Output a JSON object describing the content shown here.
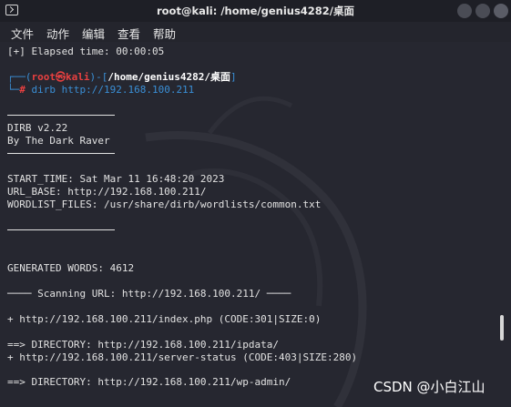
{
  "window": {
    "title": "root@kali: /home/genius4282/桌面"
  },
  "menu": [
    "文件",
    "动作",
    "编辑",
    "查看",
    "帮助"
  ],
  "terminal": {
    "elapsed": "[+] Elapsed time: 00:00:05",
    "prompt": {
      "open": "┌──(",
      "user": "root㉿kali",
      "mid": ")-[",
      "path": "/home/genius4282/桌面",
      "close": "]",
      "hash_prefix": "└─",
      "hash": "#",
      "command": " dirb http://192.168.100.211"
    },
    "dirb_version": "DIRB v2.22",
    "dirb_author": "By The Dark Raver",
    "start_time": "START_TIME: Sat Mar 11 16:48:20 2023",
    "url_base": "URL_BASE: http://192.168.100.211/",
    "wordlist": "WORDLIST_FILES: /usr/share/dirb/wordlists/common.txt",
    "generated_words": "GENERATED WORDS: 4612",
    "scanning": "──── Scanning URL: http://192.168.100.211/ ────",
    "result1": "+ http://192.168.100.211/index.php (CODE:301|SIZE:0)",
    "dir1": "==> DIRECTORY: http://192.168.100.211/ipdata/",
    "result2": "+ http://192.168.100.211/server-status (CODE:403|SIZE:280)",
    "dir2": "==> DIRECTORY: http://192.168.100.211/wp-admin/"
  },
  "watermark": "CSDN @小白江山",
  "colors": {
    "prompt_blue": "#3a8fd6",
    "prompt_red": "#e84040",
    "bracket_green": "#9ac5c3",
    "background": "#262730"
  }
}
